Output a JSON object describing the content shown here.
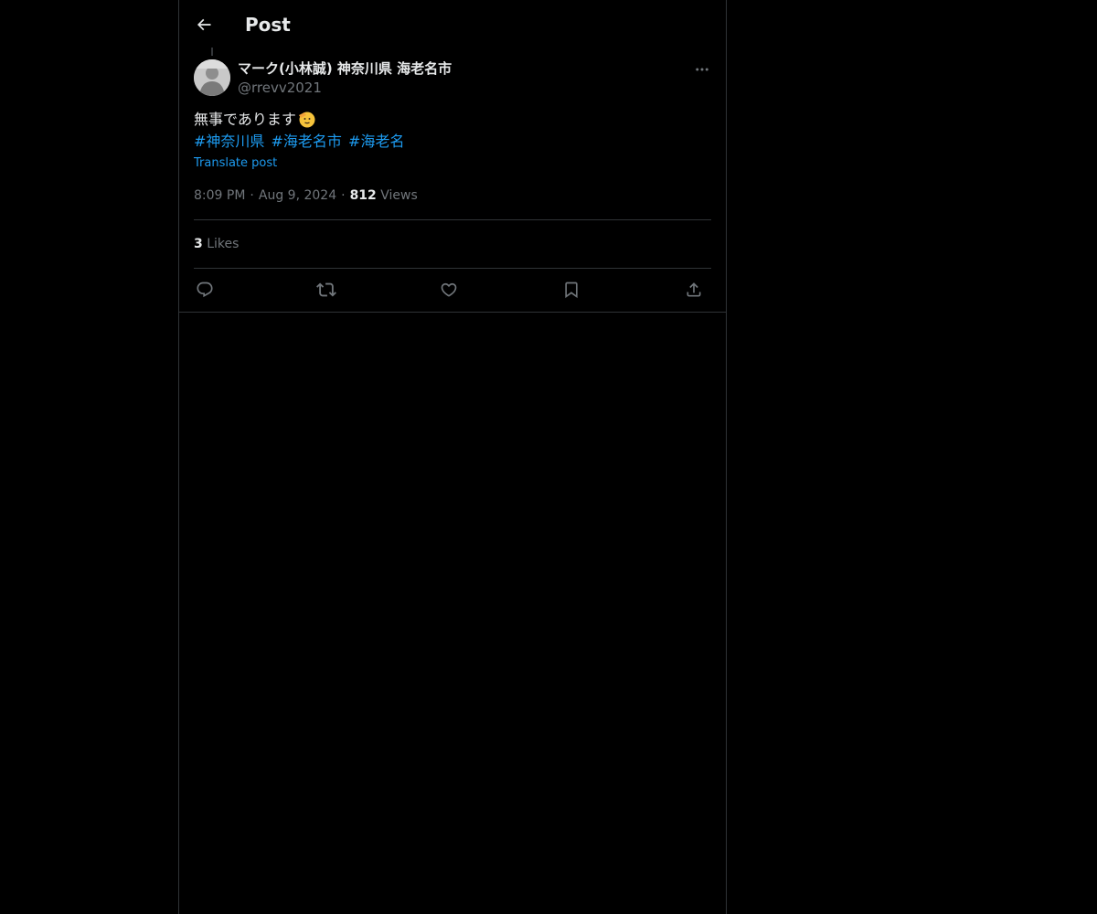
{
  "header": {
    "title": "Post"
  },
  "post": {
    "author": {
      "display_name": "マーク(小林誠) 神奈川県 海老名市",
      "handle": "@rrevv2021"
    },
    "text": "無事であります",
    "hashtags": [
      "#神奈川県",
      "#海老名市",
      "#海老名"
    ],
    "translate_label": "Translate post",
    "time": "8:09 PM",
    "date": "Aug 9, 2024",
    "separator": "·",
    "views_count": "812",
    "views_label": "Views",
    "likes_count": "3",
    "likes_label": "Likes"
  },
  "icons": {
    "back": "arrow-left-icon",
    "more": "more-horizontal-icon",
    "emoji": "saluting-face-emoji",
    "reply": "reply-icon",
    "repost": "repost-icon",
    "like": "heart-icon",
    "bookmark": "bookmark-icon",
    "share": "share-icon"
  },
  "colors": {
    "background": "#000000",
    "text": "#e7e9ea",
    "muted": "#71767b",
    "accent": "#1d9bf0",
    "border": "#2f3336"
  }
}
